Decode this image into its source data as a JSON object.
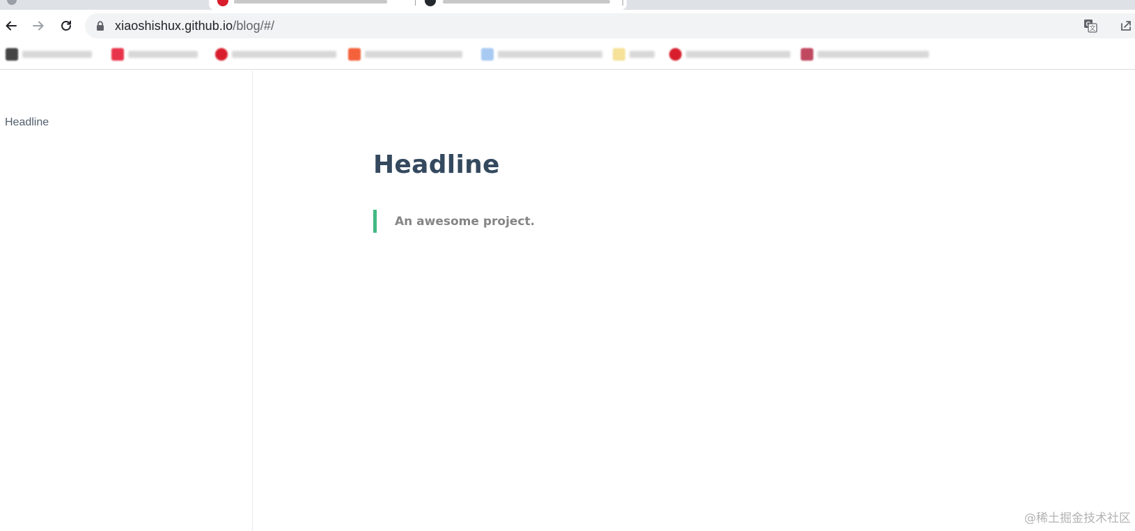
{
  "browser": {
    "url_host": "xiaoshishux.github.io",
    "url_path": "/blog/#/"
  },
  "sidebar": {
    "items": [
      {
        "label": "Headline"
      }
    ]
  },
  "main": {
    "title": "Headline",
    "quote": "An awesome project."
  },
  "watermark": "@稀土掘金技术社区",
  "colors": {
    "accent": "#42b983",
    "heading": "#34495e",
    "quote_text": "#858585",
    "sidebar_text": "#505d6b"
  }
}
